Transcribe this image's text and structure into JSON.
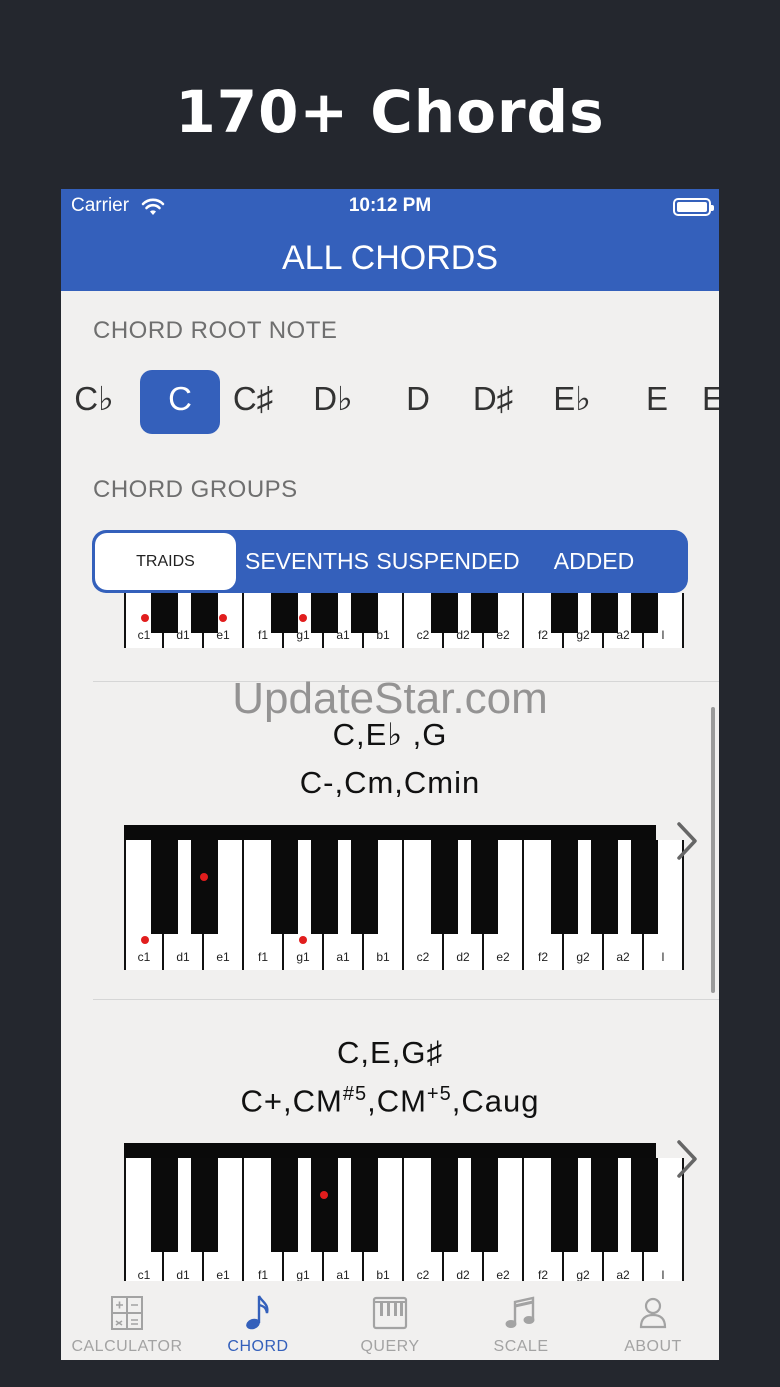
{
  "promo": {
    "title": "170+ Chords"
  },
  "status_bar": {
    "carrier": "Carrier",
    "time": "10:12 PM"
  },
  "nav": {
    "title": "ALL CHORDS"
  },
  "root_section": {
    "label": "CHORD ROOT NOTE",
    "notes": [
      "C♭",
      "C",
      "C♯",
      "D♭",
      "D",
      "D♯",
      "E♭",
      "E",
      "E"
    ],
    "selected": "C"
  },
  "groups_section": {
    "label": "CHORD GROUPS",
    "segments": [
      "TRAIDS",
      "SEVENTHS",
      "SUSPENDED",
      "ADDED"
    ],
    "selected": "TRAIDS"
  },
  "watermark": "UpdateStar.com",
  "keyboard": {
    "white_labels": [
      "c1",
      "d1",
      "e1",
      "f1",
      "g1",
      "a1",
      "b1",
      "c2",
      "d2",
      "e2",
      "f2",
      "g2",
      "a2",
      "l"
    ]
  },
  "chords": [
    {
      "notes": "",
      "names": "",
      "highlighted": [
        "c1",
        "e1",
        "g1"
      ]
    },
    {
      "notes": "C,E♭ ,G",
      "names": "C-,Cm,Cmin",
      "highlighted": [
        "c1",
        "d#1",
        "g1"
      ]
    },
    {
      "notes": "C,E,G♯",
      "names_parts": [
        "C+,CM",
        "#5",
        ",CM",
        "+5",
        ",Caug"
      ],
      "highlighted": [
        "g#1"
      ]
    }
  ],
  "tabbar": {
    "items": [
      {
        "label": "CALCULATOR",
        "icon": "calculator-icon"
      },
      {
        "label": "CHORD",
        "icon": "music-note-icon"
      },
      {
        "label": "QUERY",
        "icon": "piano-keys-icon"
      },
      {
        "label": "SCALE",
        "icon": "music-notes-icon"
      },
      {
        "label": "ABOUT",
        "icon": "person-icon"
      }
    ],
    "active": "CHORD"
  },
  "colors": {
    "accent": "#3460bb",
    "background": "#24272e",
    "content_bg": "#f1f0ef",
    "dot": "#e11d1d"
  }
}
